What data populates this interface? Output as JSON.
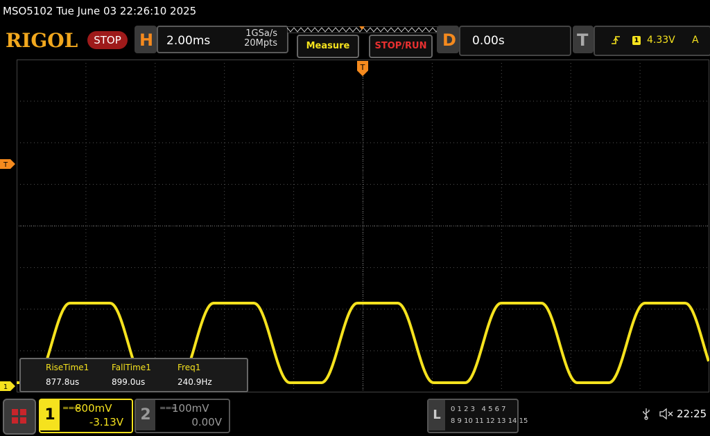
{
  "title": "MSO5102  Tue June 03 22:26:10 2025",
  "brand": "RIGOL",
  "run_status": "STOP",
  "horizontal": {
    "letter": "H",
    "timebase": "2.00ms",
    "sample_rate": "1GSa/s",
    "memory_depth": "20Mpts"
  },
  "buttons": {
    "measure": "Measure",
    "stop_run": "STOP/RUN"
  },
  "delay": {
    "letter": "D",
    "value": "0.00s"
  },
  "trigger": {
    "letter": "T",
    "source": "1",
    "level": "4.33V",
    "mode": "A"
  },
  "markers": {
    "trigger_level": "T",
    "trigger_position": "T",
    "channel1_ground": "1"
  },
  "measurements": [
    {
      "label": "RiseTime1",
      "value": "877.8us"
    },
    {
      "label": "FallTime1",
      "value": "899.0us"
    },
    {
      "label": "Freq1",
      "value": "240.9Hz"
    }
  ],
  "channels": [
    {
      "number": "1",
      "coupling": "===",
      "scale": "800mV",
      "offset": "-3.13V",
      "color": "#f5e21e",
      "active": true
    },
    {
      "number": "2",
      "coupling": "===",
      "scale": "100mV",
      "offset": "0.00V",
      "color": "#999999",
      "active": false
    }
  ],
  "logic_analyzer": {
    "letter": "L",
    "row1": "0 1 2 3   4 5 6 7",
    "row2": "8 9 10 11 12 13 14 15"
  },
  "status": {
    "usb_icon": "usb-icon",
    "speaker_icon": "speaker-muted-icon",
    "clock": "22:25"
  },
  "colors": {
    "waveform": "#f5e21e",
    "brand": "#f2a81e",
    "stop": "#9e1a1a",
    "accent": "#f58a1e"
  },
  "waveform": {
    "frequency_hz": 240.9,
    "timebase_s_per_div": 0.002,
    "volts_per_div": 0.8,
    "offset_v": -3.13
  }
}
